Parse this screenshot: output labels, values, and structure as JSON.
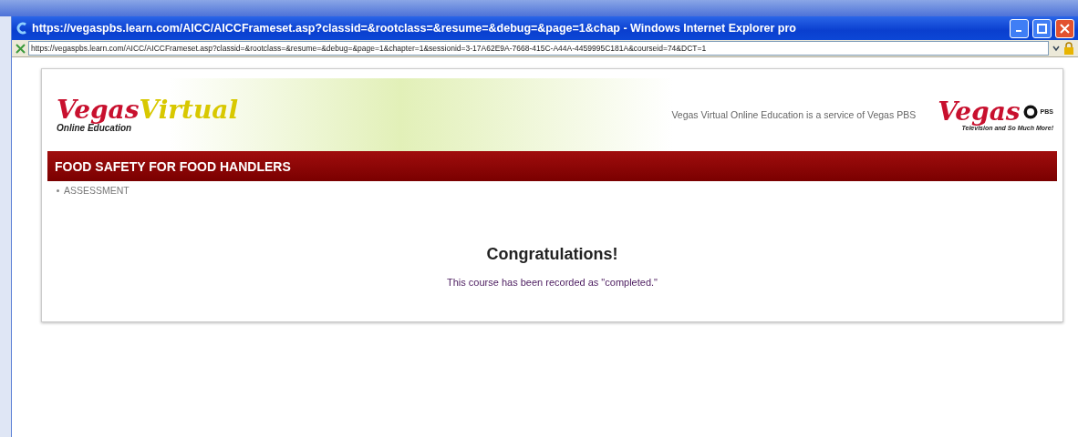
{
  "window": {
    "title": "https://vegaspbs.learn.com/AICC/AICCFrameset.asp?classid=&rootclass=&resume=&debug=&page=1&chap - Windows Internet Explorer pro"
  },
  "address_bar": {
    "url": "https://vegaspbs.learn.com/AICC/AICCFrameset.asp?classid=&rootclass=&resume=&debug=&page=1&chapter=1&sessionid=3-17A62E9A-7668-415C-A44A-4459995C181A&courseid=74&DCT=1"
  },
  "header": {
    "logo_script": "Vegas",
    "logo_script_2": "Virtual",
    "logo_tagline": "Online Education",
    "service_text": "Vegas Virtual Online Education is a service of Vegas PBS",
    "pbs_logo_script": "Vegas",
    "pbs_mark": "PBS",
    "pbs_tagline": "Television and So Much More!"
  },
  "course": {
    "title": "FOOD SAFETY FOR FOOD HANDLERS",
    "breadcrumb": "ASSESSMENT"
  },
  "message": {
    "heading": "Congratulations!",
    "body": "This course has been recorded as \"completed.\""
  }
}
